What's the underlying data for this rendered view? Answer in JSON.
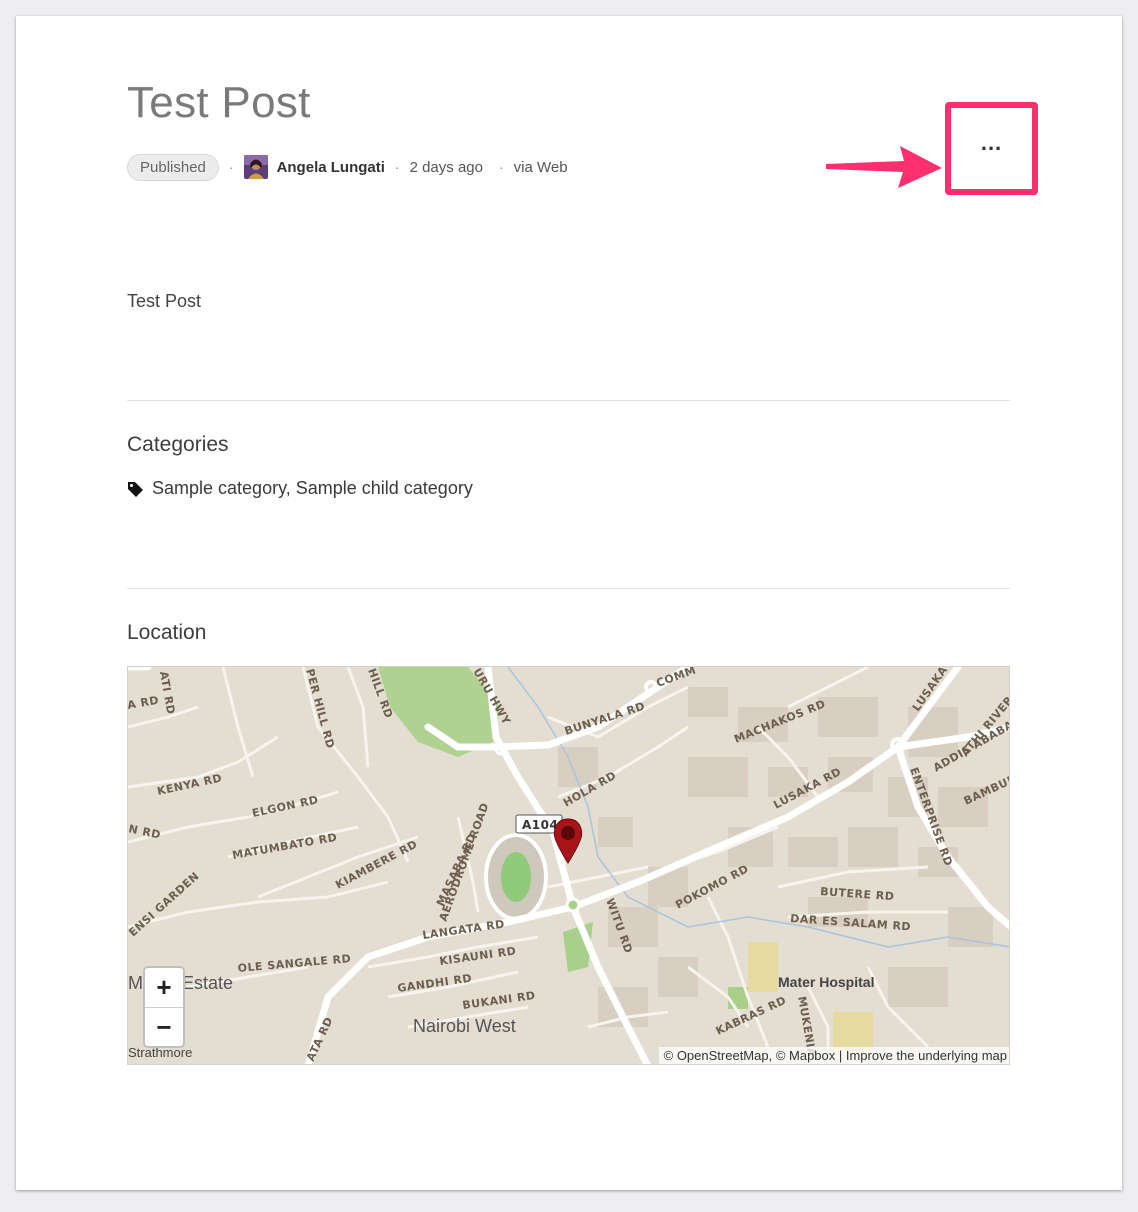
{
  "post": {
    "title": "Test Post",
    "status": "Published",
    "author": "Angela Lungati",
    "time_ago": "2 days ago",
    "source": "via Web",
    "more_label": "...",
    "body": "Test Post"
  },
  "categories": {
    "heading": "Categories",
    "value": "Sample category, Sample child category",
    "icon": "tag-icon"
  },
  "location": {
    "heading": "Location",
    "zoom_in": "+",
    "zoom_out": "−",
    "attribution": "© OpenStreetMap, © Mapbox | Improve the underlying map",
    "map_labels": {
      "kenya_rd": "KENYA RD",
      "elgon_rd": "ELGON RD",
      "matumbato_rd": "MATUMBATO RD",
      "kiambere_rd": "KIAMBERE RD",
      "masaba_rd": "MASABA RD",
      "aerodrome_road": "AERODROME ROAD",
      "langata_rd": "LANGATA RD",
      "kisauni_rd": "KISAUNI RD",
      "gandhi_rd": "GANDHI RD",
      "bukani_rd": "BUKANI RD",
      "ole_sangale_rd": "OLE SANGALE RD",
      "bunyala_rd": "BUNYALA RD",
      "hola_rd": "HOLA RD",
      "machakos_rd": "MACHAKOS RD",
      "lusaka_rd": "LUSAKA RD",
      "lusaka": "LUSAKA",
      "pokomo_rd": "POKOMO RD",
      "butere_rd": "BUTERE RD",
      "dar_es_salam_rd": "DAR ES SALAM RD",
      "enterprise_rd": "ENTERPRISE RD",
      "witu_rd": "WITU RD",
      "kabras_rd": "KABRAS RD",
      "mukenia": "MUKENIA",
      "athi_river": "ATHI RIVER R",
      "addis_ababa": "ADDIS ABABA",
      "bambur": "BAMBUR",
      "a104": "A104",
      "mater_hospital": "Mater Hospital",
      "nairobi_west": "Nairobi West",
      "estate": "M     aka Estate",
      "strathmore": "Strathmore",
      "per_hill_rd": "PER HILL RD",
      "hill_rd": "HILL RD",
      "uru_hwy": "URU HWY",
      "comm": "COMM",
      "ensi_garden": "ENSI GARDEN",
      "ata_rd": "ATA RD",
      "ati_rd": "ATI RD",
      "a_rd": "A RD",
      "n_rd": "N RD"
    }
  },
  "colors": {
    "accent": "#ff2e6f",
    "marker": "#a8141a",
    "map_bg": "#e3ddd2",
    "park": "#a9d08a"
  }
}
